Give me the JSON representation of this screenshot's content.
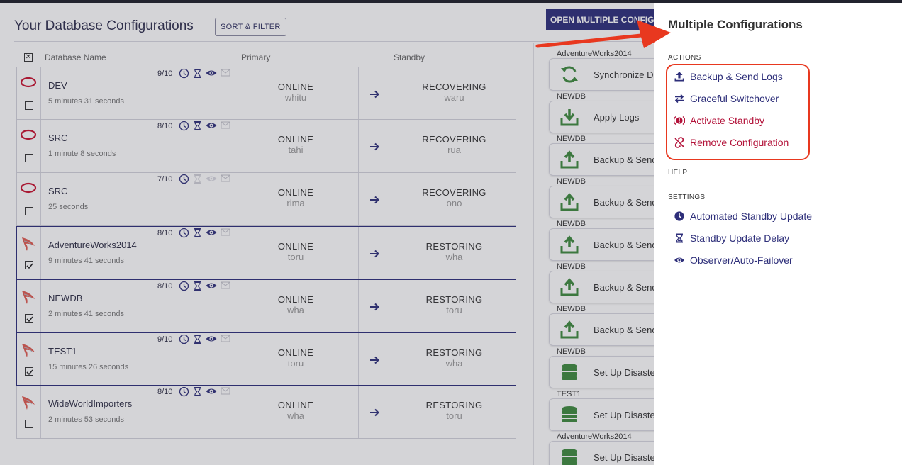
{
  "page": {
    "title": "Your Database Configurations",
    "sort_filter": "SORT & FILTER",
    "open_multiple": "OPEN MULTIPLE CONFIGURATIONS"
  },
  "table": {
    "headers": {
      "name": "Database Name",
      "primary": "Primary",
      "standby": "Standby"
    },
    "rows": [
      {
        "icon": "oracle-icon",
        "name": "DEV",
        "time": "5 minutes 31 seconds",
        "score": "9/10",
        "primary_status": "ONLINE",
        "primary_host": "whitu",
        "standby_status": "RECOVERING",
        "standby_host": "waru",
        "selected": false
      },
      {
        "icon": "oracle-icon",
        "name": "SRC",
        "time": "1 minute 8 seconds",
        "score": "8/10",
        "primary_status": "ONLINE",
        "primary_host": "tahi",
        "standby_status": "RECOVERING",
        "standby_host": "rua",
        "selected": false
      },
      {
        "icon": "oracle-icon",
        "name": "SRC",
        "time": "25 seconds",
        "score": "7/10",
        "primary_status": "ONLINE",
        "primary_host": "rima",
        "standby_status": "RECOVERING",
        "standby_host": "ono",
        "selected": false
      },
      {
        "icon": "sqlserver-icon",
        "name": "AdventureWorks2014",
        "time": "9 minutes 41 seconds",
        "score": "8/10",
        "primary_status": "ONLINE",
        "primary_host": "toru",
        "standby_status": "RESTORING",
        "standby_host": "wha",
        "selected": true
      },
      {
        "icon": "sqlserver-icon",
        "name": "NEWDB",
        "time": "2 minutes 41 seconds",
        "score": "8/10",
        "primary_status": "ONLINE",
        "primary_host": "wha",
        "standby_status": "RESTORING",
        "standby_host": "toru",
        "selected": true
      },
      {
        "icon": "sqlserver-icon",
        "name": "TEST1",
        "time": "15 minutes 26 seconds",
        "score": "9/10",
        "primary_status": "ONLINE",
        "primary_host": "toru",
        "standby_status": "RESTORING",
        "standby_host": "wha",
        "selected": true
      },
      {
        "icon": "sqlserver-icon",
        "name": "WideWorldImporters",
        "time": "2 minutes 53 seconds",
        "score": "8/10",
        "primary_status": "ONLINE",
        "primary_host": "wha",
        "standby_status": "RESTORING",
        "standby_host": "toru",
        "selected": false
      }
    ]
  },
  "cards": [
    {
      "label": "AdventureWorks2014",
      "action": "Synchronize Databases",
      "icon": "sync-icon"
    },
    {
      "label": "NEWDB",
      "action": "Apply Logs",
      "icon": "download-icon"
    },
    {
      "label": "NEWDB",
      "action": "Backup & Send Logs",
      "icon": "upload-icon"
    },
    {
      "label": "NEWDB",
      "action": "Backup & Send Logs",
      "icon": "upload-icon"
    },
    {
      "label": "NEWDB",
      "action": "Backup & Send Logs",
      "icon": "upload-icon"
    },
    {
      "label": "NEWDB",
      "action": "Backup & Send Logs",
      "icon": "upload-icon"
    },
    {
      "label": "NEWDB",
      "action": "Backup & Send Logs",
      "icon": "upload-icon"
    },
    {
      "label": "NEWDB",
      "action": "Set Up Disaster Recovery",
      "icon": "database-icon"
    },
    {
      "label": "TEST1",
      "action": "Set Up Disaster Recovery",
      "icon": "database-icon"
    },
    {
      "label": "AdventureWorks2014",
      "action": "Set Up Disaster Recovery",
      "icon": "database-icon"
    }
  ],
  "panel": {
    "title": "Multiple Configurations",
    "actions_header": "ACTIONS",
    "actions": [
      {
        "label": "Backup & Send Logs",
        "icon": "upload-icon"
      },
      {
        "label": "Graceful Switchover",
        "icon": "switch-arrows-icon"
      },
      {
        "label": "Activate Standby",
        "icon": "alert-icon"
      },
      {
        "label": "Remove Configuration",
        "icon": "unlink-icon"
      }
    ],
    "help_header": "HELP",
    "settings_header": "SETTINGS",
    "settings": [
      {
        "label": "Automated Standby Update",
        "icon": "clock-icon"
      },
      {
        "label": "Standby Update Delay",
        "icon": "hourglass-icon"
      },
      {
        "label": "Observer/Auto-Failover",
        "icon": "eye-icon"
      }
    ]
  },
  "colors": {
    "navy": "#2e2f7a",
    "danger": "#b3133a",
    "highlight": "#e8381f",
    "oracle": "#c8102e",
    "success": "#3d8a3d"
  }
}
